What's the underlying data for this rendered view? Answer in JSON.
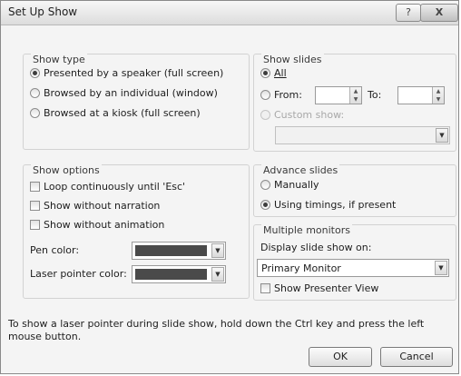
{
  "window": {
    "title": "Set Up Show",
    "help_label": "?",
    "close_label": "X"
  },
  "show_type": {
    "title": "Show type",
    "options": [
      {
        "label": "Presented by a speaker (full screen)",
        "selected": true
      },
      {
        "label": "Browsed by an individual (window)",
        "selected": false
      },
      {
        "label": "Browsed at a kiosk (full screen)",
        "selected": false
      }
    ]
  },
  "show_slides": {
    "title": "Show slides",
    "all_label": "All",
    "from_label": "From:",
    "to_label": "To:",
    "from_value": "",
    "to_value": "",
    "custom_label": "Custom show:",
    "custom_value": "",
    "selected": "all"
  },
  "show_options": {
    "title": "Show options",
    "checkboxes": [
      {
        "label": "Loop continuously until 'Esc'",
        "checked": false
      },
      {
        "label": "Show without narration",
        "checked": false
      },
      {
        "label": "Show without animation",
        "checked": false
      }
    ],
    "pen_color_label": "Pen color:",
    "laser_color_label": "Laser pointer color:",
    "pen_color": "#4a4a4a",
    "laser_color": "#4a4a4a"
  },
  "advance_slides": {
    "title": "Advance slides",
    "options": [
      {
        "label": "Manually",
        "selected": false
      },
      {
        "label": "Using timings, if present",
        "selected": true
      }
    ]
  },
  "multiple_monitors": {
    "title": "Multiple monitors",
    "display_label": "Display slide show on:",
    "monitor_value": "Primary Monitor",
    "presenter_view_label": "Show Presenter View",
    "presenter_view_checked": false
  },
  "info_text": "To show a laser pointer during slide show, hold down the Ctrl key and press the left mouse button.",
  "buttons": {
    "ok": "OK",
    "cancel": "Cancel"
  },
  "icons": {
    "dropdown": "chevron-down-icon",
    "spin_up": "spin-up-icon",
    "spin_down": "spin-down-icon"
  },
  "colors": {
    "dialog_bg": "#f4f4f4",
    "close_button": "#c8c8c8"
  }
}
